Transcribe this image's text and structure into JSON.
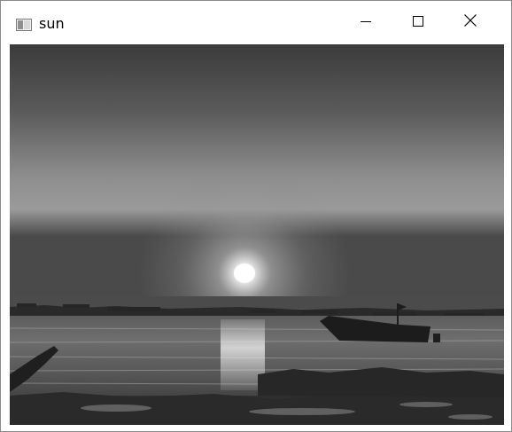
{
  "window": {
    "title": "sun",
    "icon": "window-app-icon",
    "controls": {
      "minimize_icon": "minimize-icon",
      "maximize_icon": "maximize-icon",
      "close_icon": "close-icon"
    }
  },
  "image": {
    "description_icon": "grayscale-sunset-photo",
    "colors": {
      "sky_top": "#3a3a3a",
      "sky_mid": "#8a8a8a",
      "sky_glow": "#ffffff",
      "horizon": "#4a4a4a",
      "water": "#7a7a7a",
      "foreground": "#1e1e1e"
    }
  }
}
